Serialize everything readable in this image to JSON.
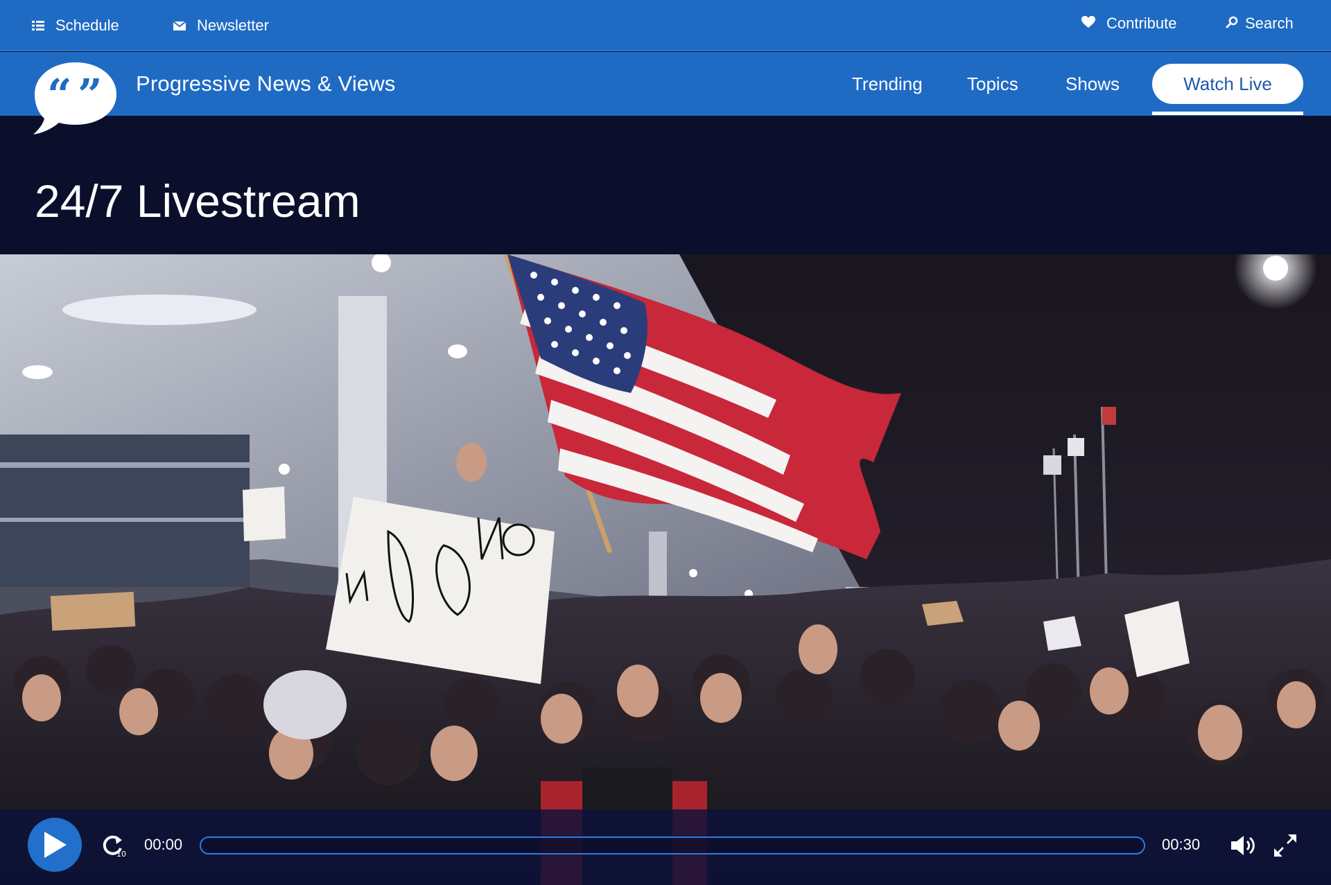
{
  "utility": {
    "schedule_label": "Schedule",
    "newsletter_label": "Newsletter",
    "contribute_label": "Contribute",
    "search_label": "Search"
  },
  "site": {
    "title": "Progressive News & Views"
  },
  "nav": {
    "items": [
      {
        "label": "Trending"
      },
      {
        "label": "Topics"
      },
      {
        "label": "Shows"
      }
    ],
    "watch_live_label": "Watch Live"
  },
  "page": {
    "title": "24/7 Livestream"
  },
  "player": {
    "current_time": "00:00",
    "total_time": "00:30",
    "progress_fraction": 0,
    "replay_seconds": "10"
  },
  "colors": {
    "brand_blue": "#1f6bc4",
    "page_dark": "#0c0f2b",
    "accent_blue": "#2f7be0"
  }
}
